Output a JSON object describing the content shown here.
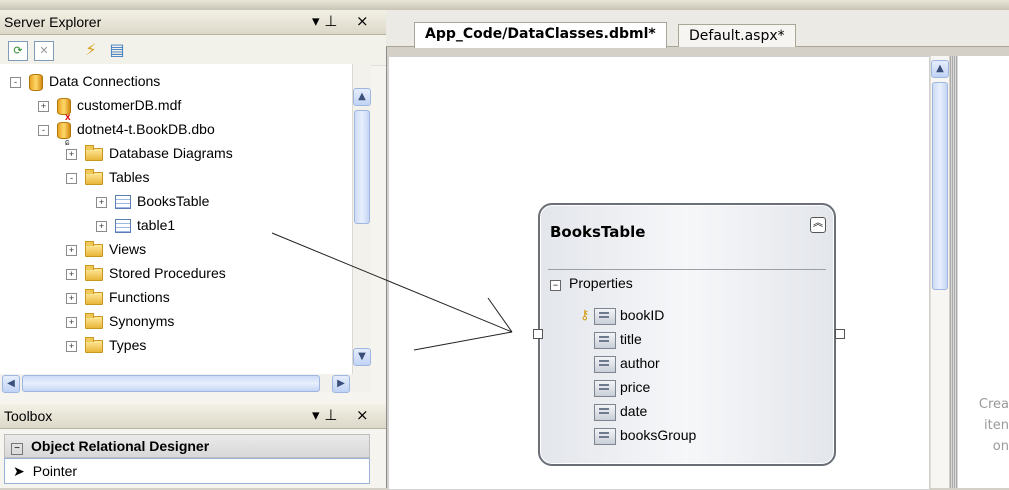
{
  "server_explorer": {
    "title": "Server Explorer",
    "pin": "↓ Ч",
    "close": "×",
    "tree": [
      {
        "label": "Data Connections",
        "expander": "-",
        "icon": "db"
      },
      {
        "label": "customerDB.mdf",
        "expander": "+",
        "icon": "db-error"
      },
      {
        "label": "dotnet4-t.BookDB.dbo",
        "expander": "-",
        "icon": "db-connected"
      },
      {
        "label": "Database Diagrams",
        "expander": "+",
        "icon": "folder"
      },
      {
        "label": "Tables",
        "expander": "-",
        "icon": "folder"
      },
      {
        "label": "BooksTable",
        "expander": "+",
        "icon": "table"
      },
      {
        "label": "table1",
        "expander": "+",
        "icon": "table"
      },
      {
        "label": "Views",
        "expander": "+",
        "icon": "folder"
      },
      {
        "label": "Stored Procedures",
        "expander": "+",
        "icon": "folder"
      },
      {
        "label": "Functions",
        "expander": "+",
        "icon": "folder"
      },
      {
        "label": "Synonyms",
        "expander": "+",
        "icon": "folder"
      },
      {
        "label": "Types",
        "expander": "+",
        "icon": "folder"
      }
    ]
  },
  "toolbox": {
    "title": "Toolbox",
    "group": "Object Relational Designer",
    "item": "Pointer"
  },
  "tabs": [
    {
      "label": "App_Code/DataClasses.dbml*",
      "active": true
    },
    {
      "label": "Default.aspx*",
      "active": false
    }
  ],
  "entity": {
    "title": "BooksTable",
    "section": "Properties",
    "properties": [
      "bookID",
      "title",
      "author",
      "price",
      "date",
      "booksGroup"
    ],
    "primary_key": "bookID"
  },
  "right_hint": [
    "Crea",
    "iten",
    "on"
  ]
}
